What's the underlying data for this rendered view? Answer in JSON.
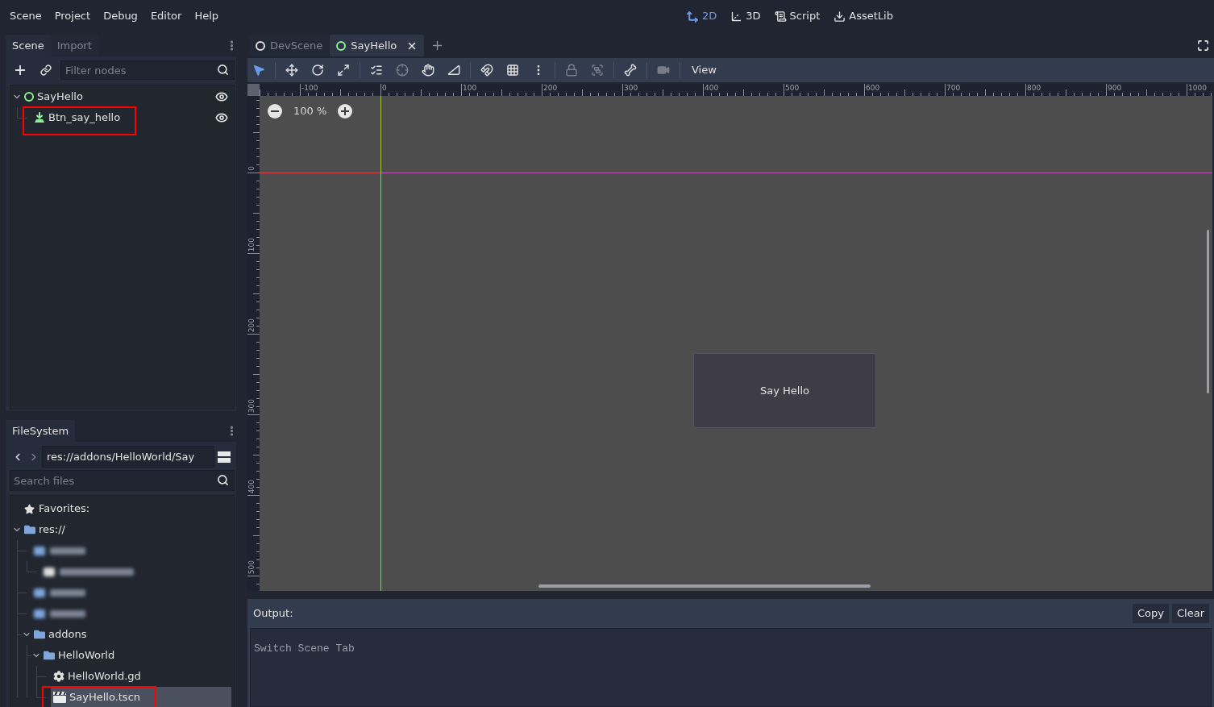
{
  "menu_bar": {
    "menus": [
      "Scene",
      "Project",
      "Debug",
      "Editor",
      "Help"
    ],
    "workspaces": [
      {
        "label": "2D",
        "kind": "canvas",
        "selected": true
      },
      {
        "label": "3D",
        "kind": "spatial",
        "selected": false
      },
      {
        "label": "Script",
        "kind": "script",
        "selected": false
      },
      {
        "label": "AssetLib",
        "kind": "assetlib",
        "selected": false
      }
    ]
  },
  "scene_dock": {
    "tabs": [
      {
        "label": "Scene",
        "selected": true
      },
      {
        "label": "Import",
        "selected": false
      }
    ],
    "filter": {
      "placeholder": "Filter nodes"
    },
    "tree": [
      {
        "name": "SayHello",
        "kind": "control",
        "expanded": true,
        "visible": true,
        "selected": false,
        "highlighted": false,
        "children": [
          {
            "name": "Btn_say_hello",
            "kind": "button",
            "visible": true,
            "selected": false,
            "highlighted": true
          }
        ]
      }
    ]
  },
  "filesystem_dock": {
    "tabs": [
      {
        "label": "FileSystem",
        "selected": true
      }
    ],
    "path": "res://addons/HelloWorld/Say",
    "search": {
      "placeholder": "Search files"
    },
    "favorites": "Favorites:",
    "tree": [
      {
        "name": "res://",
        "kind": "folder",
        "expanded": true,
        "redacted": false,
        "selected": false,
        "highlighted": false,
        "children": [
          {
            "kind": "folder",
            "redacted": true,
            "selected": false,
            "highlighted": false,
            "children": [
              {
                "kind": "scene",
                "redacted": true,
                "selected": false,
                "highlighted": false
              }
            ]
          },
          {
            "kind": "folder",
            "redacted": true,
            "selected": false,
            "highlighted": false
          },
          {
            "kind": "folder",
            "redacted": true,
            "selected": false,
            "highlighted": false
          },
          {
            "name": "addons",
            "kind": "folder",
            "expanded": true,
            "redacted": false,
            "selected": false,
            "highlighted": false,
            "children": [
              {
                "name": "HelloWorld",
                "kind": "folder",
                "expanded": true,
                "redacted": false,
                "selected": false,
                "highlighted": false,
                "children": [
                  {
                    "name": "HelloWorld.gd",
                    "kind": "script",
                    "redacted": false,
                    "selected": false,
                    "highlighted": false
                  },
                  {
                    "name": "SayHello.tscn",
                    "kind": "scene",
                    "redacted": false,
                    "selected": true,
                    "highlighted": true
                  }
                ]
              }
            ]
          }
        ]
      }
    ]
  },
  "scene_tabs": [
    {
      "label": "DevScene",
      "kind": "node",
      "selected": false
    },
    {
      "label": "SayHello",
      "kind": "control",
      "selected": true
    }
  ],
  "toolbar": {
    "groups": [
      {
        "tools": [
          {
            "kind": "select",
            "selected": true,
            "disabled": false
          }
        ]
      },
      {
        "tools": [
          {
            "kind": "move",
            "selected": false,
            "disabled": false
          },
          {
            "kind": "rotate",
            "selected": false,
            "disabled": false
          },
          {
            "kind": "scale",
            "selected": false,
            "disabled": false
          }
        ]
      },
      {
        "tools": [
          {
            "kind": "list_select",
            "selected": false,
            "disabled": false
          },
          {
            "kind": "pivot",
            "selected": false,
            "disabled": true
          },
          {
            "kind": "pan",
            "selected": false,
            "disabled": false
          },
          {
            "kind": "ruler",
            "selected": false,
            "disabled": false
          }
        ]
      },
      {
        "tools": [
          {
            "kind": "smart_snap",
            "selected": false,
            "disabled": false
          },
          {
            "kind": "grid_snap",
            "selected": false,
            "disabled": false
          },
          {
            "kind": "snap_options",
            "selected": false,
            "disabled": false
          }
        ]
      },
      {
        "tools": [
          {
            "kind": "lock",
            "selected": false,
            "disabled": true
          },
          {
            "kind": "group",
            "selected": false,
            "disabled": true
          }
        ]
      },
      {
        "tools": [
          {
            "kind": "skeleton",
            "selected": false,
            "disabled": false
          }
        ]
      },
      {
        "tools": [
          {
            "kind": "camera",
            "selected": false,
            "disabled": true
          }
        ]
      }
    ],
    "view_menu": "View"
  },
  "viewport": {
    "zoom": "100 %",
    "top_ruler": [
      "-100",
      "0",
      "100",
      "200",
      "300",
      "400",
      "500",
      "600",
      "700",
      "800",
      "900",
      "1000"
    ],
    "left_ruler": [
      "0",
      "100",
      "200",
      "300",
      "400",
      "500"
    ],
    "button": "Say Hello"
  },
  "output": {
    "title": "Output:",
    "buttons": [
      "Copy",
      "Clear"
    ],
    "lines": [
      "Switch Scene Tab"
    ]
  }
}
